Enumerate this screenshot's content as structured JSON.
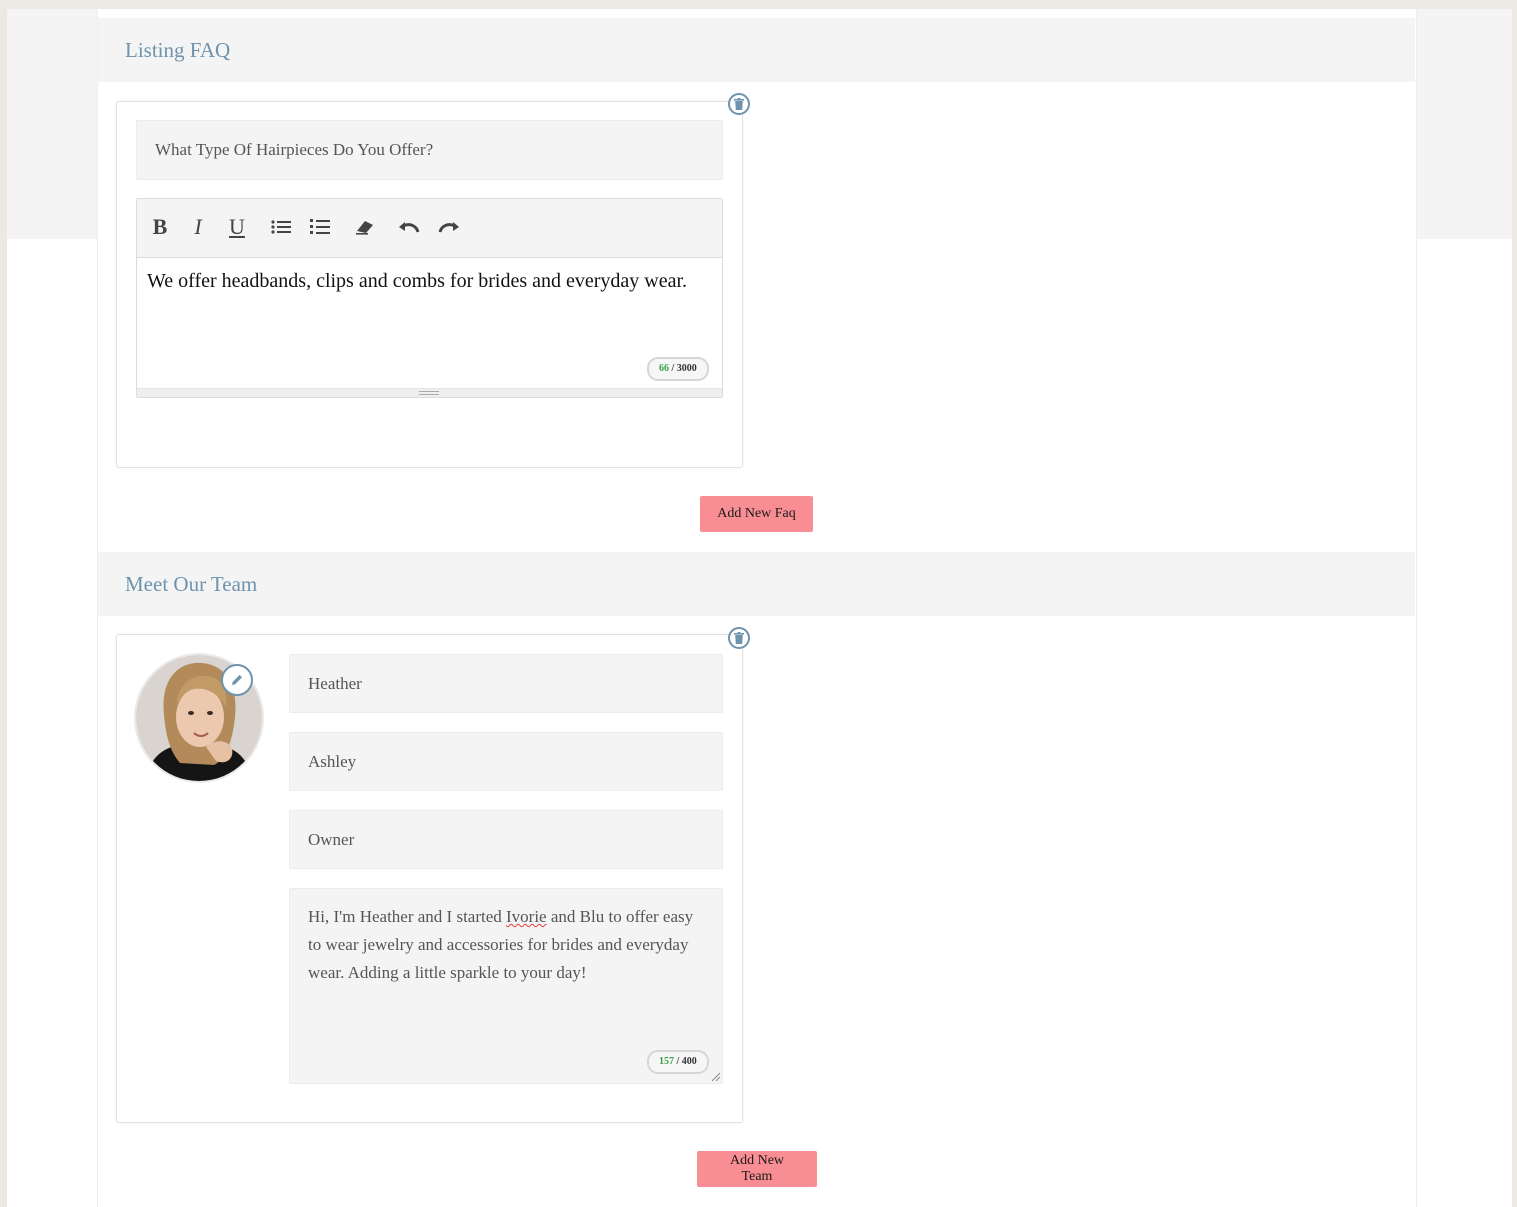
{
  "colors": {
    "accent": "#6e93ad",
    "button": "#f98d94",
    "counter_used": "#3aa14a"
  },
  "faq_section": {
    "title": "Listing FAQ",
    "items": [
      {
        "question": "What Type Of Hairpieces Do You Offer?",
        "answer": "We offer headbands, clips and combs for brides and everyday wear.",
        "counter_used": "66",
        "counter_max": "/ 3000"
      }
    ],
    "toolbar": {
      "bold": "B",
      "italic": "I",
      "underline": "U",
      "icons": [
        "bullet-list-icon",
        "numbered-list-icon",
        "eraser-icon",
        "undo-icon",
        "redo-icon"
      ]
    },
    "add_button": "Add New Faq"
  },
  "team_section": {
    "title": "Meet Our Team",
    "members": [
      {
        "first_name": "Heather",
        "last_name": "Ashley",
        "role": "Owner",
        "bio_before": "Hi, I'm Heather and I started ",
        "bio_misspelled": "Ivorie",
        "bio_after": " and Blu to offer easy to wear jewelry and accessories for brides and everyday wear. Adding a little sparkle to your day!",
        "counter_used": "157",
        "counter_max": "/ 400"
      }
    ],
    "add_button": "Add New Team"
  }
}
